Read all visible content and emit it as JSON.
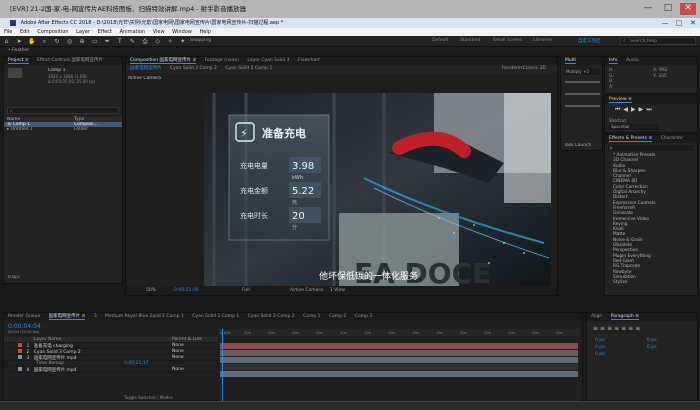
{
  "player": {
    "title": "[EVR] 21-2国-家-电-网宣传片AE科技图板、扫描特效讲解.mp4 - 射手影音播放器",
    "controls": [
      "—",
      "□",
      "✕"
    ]
  },
  "app": {
    "title": "Adobe After Effects CC 2018 - D:\\2018\\光芒\\实例\\光影\\国家电网\\国家电网宣传片\\国家电网宣传片-扫描过程.aep *",
    "menus": [
      "File",
      "Edit",
      "Composition",
      "Layer",
      "Effect",
      "Animation",
      "View",
      "Window",
      "Help"
    ],
    "workspaces": [
      "Default",
      "Standard",
      "Small Screen",
      "Libraries"
    ],
    "search_placeholder": "Search Help",
    "snapping_label": "Snapping",
    "active_workspace": "自定工作区"
  },
  "subheader": {
    "label": "• Feather"
  },
  "project": {
    "tab": "Project ≡",
    "tab2": "Effect Controls 国家电网宣传片",
    "comp_name": "Comp 1",
    "comp_info": "1920 x 1080 (1.00)",
    "comp_info2": "Δ 0;00;05;00, 25.00 fps",
    "search_icon": "⌕",
    "columns": {
      "name": "Name",
      "type": "Type"
    },
    "items": [
      {
        "name": "Comp 1",
        "type": "Composi..."
      },
      {
        "name": "Untitled 1",
        "type": "Folder"
      }
    ],
    "bpc": "8 bpc"
  },
  "composition": {
    "tabs": [
      "Composition 国家电网宣传片 ≡",
      "Footage (none)",
      "Layer Cyan Solid 3",
      "Flowchart"
    ],
    "subtabs": [
      "国家电网宣传片",
      "Cyan Solid 3 Comp 2",
      "Cyan Solid 2 Comp 1"
    ],
    "renderer": "Renderer:",
    "renderer_val": "Classic 3D",
    "active_camera": "Active Camera",
    "subtitle": "他坏保低碳的一体化服务",
    "screen": {
      "header": "准备充电",
      "rows": [
        {
          "label": "充电电量",
          "value": "3.98",
          "unit": "kWh"
        },
        {
          "label": "充电金额",
          "value": "5.22",
          "unit": "元"
        },
        {
          "label": "充电时长",
          "value": "20",
          "unit": "分"
        }
      ],
      "plate": "EA DOCE"
    },
    "footer": {
      "zoom": "50%",
      "timecode": "0:00:21:00",
      "quality": "Full",
      "camera": "Active Camera",
      "view": "1 View"
    }
  },
  "info": {
    "tabs": [
      "Multi",
      "Info",
      "Audio"
    ],
    "dropdown": "Multiply +2",
    "values": [
      "R:",
      "G:",
      "B:",
      "A:"
    ],
    "xy": [
      "X: 992",
      "Y: 335"
    ],
    "preview": "Preview ≡",
    "shortcut_label": "Shortcut",
    "shortcut_val": "Spacebar",
    "effects_tab": "Effects & Presets ≡",
    "character_tab": "Character",
    "search_placeholder": "ρ",
    "task_launch": "Task Launch",
    "effects": [
      "* Animation Presets",
      "3D Channel",
      "Audio",
      "Blur & Sharpen",
      "Channel",
      "CINEMA 4D",
      "Color Correction",
      "Digital Anarchy",
      "Distort",
      "Expression Controls",
      "FreeformR",
      "Generate",
      "Immersive Video",
      "Keying",
      "Knoll",
      "Matte",
      "Noise & Grain",
      "Obsolete",
      "Perspective",
      "Plugin Everything",
      "Red Giant",
      "RG Trapcode",
      "Rowbyte",
      "Simulation",
      "Stylize"
    ]
  },
  "timeline": {
    "tabs": [
      "Render Queue",
      "国家电网宣传片 ≡",
      "3",
      "Medium Royal Blue Solid 1 Comp 1",
      "Cyan Solid 1 Comp 1",
      "Cyan Solid 3 Comp 2",
      "Comp 1",
      "Comp 2",
      "Comp 3"
    ],
    "timecode": "0:00:04:04",
    "timecode_sub": "00104 (25.00 fps)",
    "columns": [
      "Layer Name",
      "Parent & Link"
    ],
    "layers": [
      {
        "num": "1",
        "name": "准备充电 charging",
        "parent": "None"
      },
      {
        "num": "2",
        "name": "Cyan Solid 3 Comp 2",
        "parent": "None"
      },
      {
        "num": "3",
        "name": "国家电网宣传片.mp4",
        "parent": "None"
      },
      {
        "num": "",
        "name": "Time Remap",
        "parent": "0;00;21;17"
      },
      {
        "num": "4",
        "name": "国家电网宣传片.mp4",
        "parent": "None"
      }
    ],
    "ruler": [
      "0:00s",
      "02s",
      "04s",
      "06s",
      "08s",
      "10s",
      "12s",
      "14s",
      "16s",
      "18s",
      "20s",
      "22s",
      "24s",
      "26s",
      "28s"
    ],
    "toggle_label": "Toggle Switches / Modes"
  },
  "right_bottom": {
    "tabs": [
      "Align",
      "Paragraph ≡"
    ],
    "fields": [
      "0 px",
      "0 px",
      "0 px",
      "0 px",
      "0 px"
    ]
  }
}
